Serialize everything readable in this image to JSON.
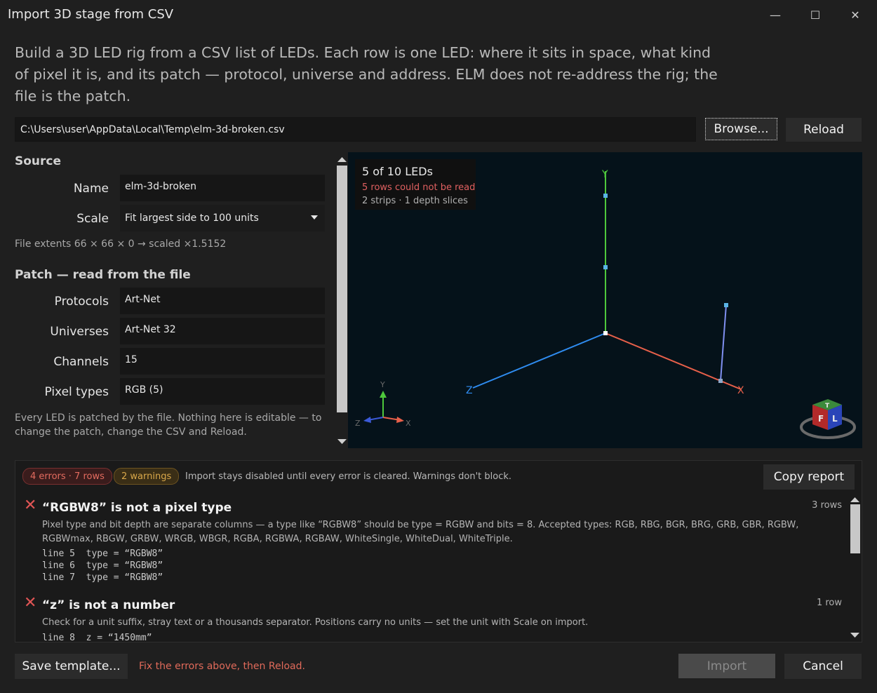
{
  "window": {
    "title": "Import 3D stage from CSV",
    "min_glyph": "—",
    "max_glyph": "☐",
    "close_glyph": "✕"
  },
  "intro": "Build a 3D LED rig from a CSV list of LEDs. Each row is one LED: where it sits in space, what kind of pixel it is, and its patch — protocol, universe and address. ELM does not re-address the rig; the file is the patch.",
  "file": {
    "path": "C:\\Users\\user\\AppData\\Local\\Temp\\elm-3d-broken.csv",
    "browse_label": "Browse...",
    "reload_label": "Reload"
  },
  "source": {
    "heading": "Source",
    "name_label": "Name",
    "name_value": "elm-3d-broken",
    "scale_label": "Scale",
    "scale_value": "Fit largest side to 100 units",
    "extents": "File extents 66 × 66 × 0 → scaled ×1.5152"
  },
  "patch": {
    "heading": "Patch — read from the file",
    "protocols_label": "Protocols",
    "protocols_value": "Art-Net",
    "universes_label": "Universes",
    "universes_value": "Art-Net 32",
    "channels_label": "Channels",
    "channels_value": "15",
    "pixel_types_label": "Pixel types",
    "pixel_types_value": "RGB (5)",
    "note": "Every LED is patched by the file. Nothing here is editable — to change the patch, change the CSV and Reload."
  },
  "viewport": {
    "count": "5 of 10 LEDs",
    "unread": "5 rows could not be read",
    "info": "2 strips · 1 depth slices",
    "axis_x": "X",
    "axis_y": "Y",
    "axis_z": "Z",
    "gizmo_x": "X",
    "gizmo_y": "Y",
    "gizmo_z": "Z",
    "cube_f": "F",
    "cube_l": "L",
    "cube_t": "T",
    "colors": {
      "x_axis": "#e8604a",
      "y_axis": "#4ec83c",
      "z_axis": "#2f8cf0",
      "led": "#5ab4e6",
      "strip": "#7f8ff0"
    }
  },
  "issues": {
    "errors_badge": "4 errors · 7 rows",
    "warnings_badge": "2 warnings",
    "summary": "Import stays disabled until every error is cleared. Warnings don't block.",
    "copy_label": "Copy report",
    "items": [
      {
        "title": "“RGBW8” is not a pixel type",
        "count": "3 rows",
        "text": "Pixel type and bit depth are separate columns — a type like “RGBW8” should be type = RGBW and bits = 8. Accepted types: RGB, RBG, BGR, BRG, GRB, GBR, RGBW, RGBWmax, RBGW, GRBW, WRGB, WBGR, RGBA, RGBWA, RGBAW, WhiteSingle, WhiteDual, WhiteTriple.",
        "lines": [
          "line 5  type = “RGBW8”",
          "line 6  type = “RGBW8”",
          "line 7  type = “RGBW8”"
        ]
      },
      {
        "title": "“z” is not a number",
        "count": "1 row",
        "text": "Check for a unit suffix, stray text or a thousands separator. Positions carry no units — set the unit with Scale on import.",
        "lines": [
          "line 8  z = “1450mm”"
        ]
      }
    ],
    "colors": {
      "error": "#e05555",
      "warning": "#d9a84a"
    }
  },
  "footer": {
    "save_label": "Save template...",
    "status": "Fix the errors above, then Reload.",
    "import_label": "Import",
    "cancel_label": "Cancel"
  }
}
